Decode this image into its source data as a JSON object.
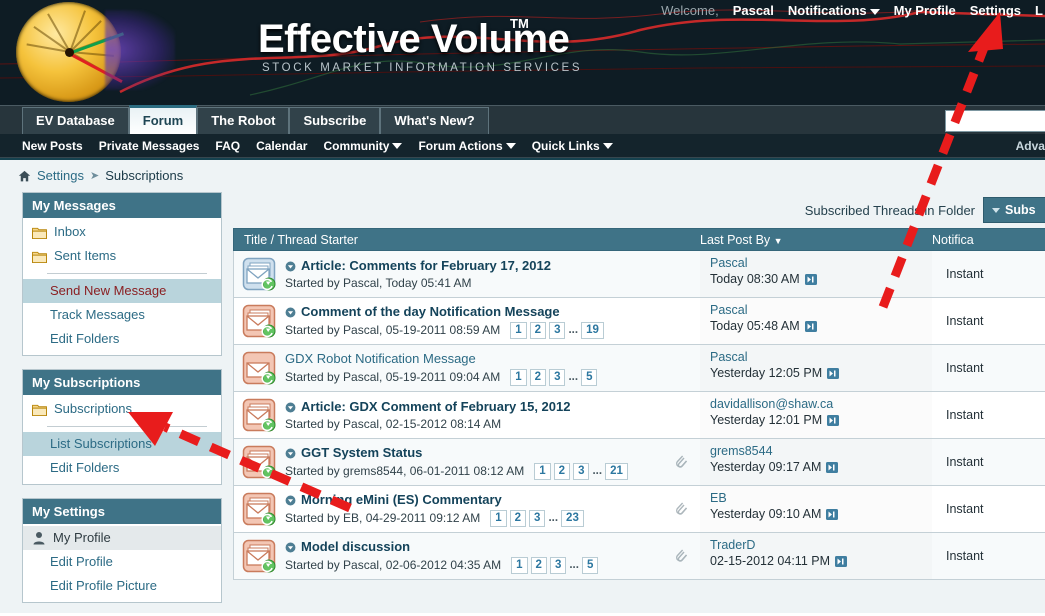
{
  "header": {
    "brand": "Effective Volume",
    "brand_tm": "TM",
    "tagline": "STOCK MARKET INFORMATION SERVICES",
    "welcome_label": "Welcome,",
    "username": "Pascal",
    "notifications": "Notifications",
    "my_profile": "My Profile",
    "settings": "Settings",
    "logout": "L"
  },
  "tabs": [
    {
      "label": "EV Database",
      "active": false
    },
    {
      "label": "Forum",
      "active": true
    },
    {
      "label": "The Robot",
      "active": false
    },
    {
      "label": "Subscribe",
      "active": false
    },
    {
      "label": "What's New?",
      "active": false
    }
  ],
  "search": {
    "value": "",
    "placeholder": ""
  },
  "subnav": {
    "items": [
      {
        "label": "New Posts",
        "caret": false
      },
      {
        "label": "Private Messages",
        "caret": false
      },
      {
        "label": "FAQ",
        "caret": false
      },
      {
        "label": "Calendar",
        "caret": false
      },
      {
        "label": "Community",
        "caret": true
      },
      {
        "label": "Forum Actions",
        "caret": true
      },
      {
        "label": "Quick Links",
        "caret": true
      }
    ],
    "advanced": "Advanc"
  },
  "breadcrumb": {
    "home_icon": "home-icon",
    "settings": "Settings",
    "separator": "➤",
    "current": "Subscriptions"
  },
  "sidebar": {
    "panels": [
      {
        "title": "My Messages",
        "items": [
          {
            "label": "Inbox",
            "icon": "folder-icon",
            "state": "normal"
          },
          {
            "label": "Sent Items",
            "icon": "folder-icon",
            "state": "normal"
          },
          {
            "divider": true
          },
          {
            "label": "Send New Message",
            "icon": "",
            "state": "selected-blue-red"
          },
          {
            "label": "Track Messages",
            "icon": "",
            "state": "indent"
          },
          {
            "label": "Edit Folders",
            "icon": "",
            "state": "indent"
          }
        ]
      },
      {
        "title": "My Subscriptions",
        "items": [
          {
            "label": "Subscriptions",
            "icon": "folder-icon",
            "state": "normal"
          },
          {
            "divider": true
          },
          {
            "label": "List Subscriptions",
            "icon": "",
            "state": "selected-blue"
          },
          {
            "label": "Edit Folders",
            "icon": "",
            "state": "indent"
          }
        ]
      },
      {
        "title": "My Settings",
        "items": [
          {
            "label": "My Profile",
            "icon": "person-icon",
            "state": "selected-gray"
          },
          {
            "label": "Edit Profile",
            "icon": "",
            "state": "indent"
          },
          {
            "label": "Edit Profile Picture",
            "icon": "",
            "state": "indent"
          }
        ]
      }
    ]
  },
  "main": {
    "folder_label": "Subscribed Threads in Folder",
    "folder_button": "Subs",
    "columns": {
      "title": "Title / Thread Starter",
      "last_post": "Last Post By",
      "last_post_sort": "▼",
      "notification": "Notifica"
    },
    "rows": [
      {
        "icon": "message-read-icon",
        "title": "Article: Comments for February 17, 2012",
        "unread": true,
        "has_popup": true,
        "starter": "Started by Pascal, Today 05:41 AM",
        "pages": [],
        "attachment": false,
        "last_user": "Pascal",
        "last_time": "Today 08:30 AM",
        "notification": "Instant"
      },
      {
        "icon": "message-unread-icon",
        "title": "Comment of the day Notification Message",
        "unread": true,
        "has_popup": true,
        "starter": "Started by Pascal, 05-19-2011 08:59 AM",
        "pages": [
          "1",
          "2",
          "3",
          "...",
          "19"
        ],
        "attachment": false,
        "last_user": "Pascal",
        "last_time": "Today 05:48 AM",
        "notification": "Instant"
      },
      {
        "icon": "message-single-icon",
        "title": "GDX Robot Notification Message",
        "unread": false,
        "has_popup": false,
        "starter": "Started by Pascal, 05-19-2011 09:04 AM",
        "pages": [
          "1",
          "2",
          "3",
          "...",
          "5"
        ],
        "attachment": false,
        "last_user": "Pascal",
        "last_time": "Yesterday 12:05 PM",
        "notification": "Instant"
      },
      {
        "icon": "message-unread-icon",
        "title": "Article: GDX Comment of February 15, 2012",
        "unread": true,
        "has_popup": true,
        "starter": "Started by Pascal, 02-15-2012 08:14 AM",
        "pages": [],
        "attachment": false,
        "last_user": "davidallison@shaw.ca",
        "last_time": "Yesterday 12:01 PM",
        "notification": "Instant"
      },
      {
        "icon": "message-unread-icon",
        "title": "GGT System Status",
        "unread": true,
        "has_popup": true,
        "starter": "Started by grems8544, 06-01-2011 08:12 AM",
        "pages": [
          "1",
          "2",
          "3",
          "...",
          "21"
        ],
        "attachment": true,
        "last_user": "grems8544",
        "last_time": "Yesterday 09:17 AM",
        "notification": "Instant"
      },
      {
        "icon": "message-unread-icon",
        "title": "Morning eMini (ES) Commentary",
        "unread": true,
        "has_popup": true,
        "starter": "Started by EB, 04-29-2011 09:12 AM",
        "pages": [
          "1",
          "2",
          "3",
          "...",
          "23"
        ],
        "attachment": true,
        "last_user": "EB",
        "last_time": "Yesterday 09:10 AM",
        "notification": "Instant"
      },
      {
        "icon": "message-unread-icon",
        "title": "Model discussion",
        "unread": true,
        "has_popup": true,
        "starter": "Started by Pascal, 02-06-2012 04:35 AM",
        "pages": [
          "1",
          "2",
          "3",
          "...",
          "5"
        ],
        "attachment": true,
        "last_user": "TraderD",
        "last_time": "02-15-2012 04:11 PM",
        "notification": "Instant"
      }
    ]
  },
  "annotations": {
    "color": "#e81c1c",
    "arrow1_target": "settings-link",
    "arrow2_target": "sidebar-subscriptions"
  }
}
